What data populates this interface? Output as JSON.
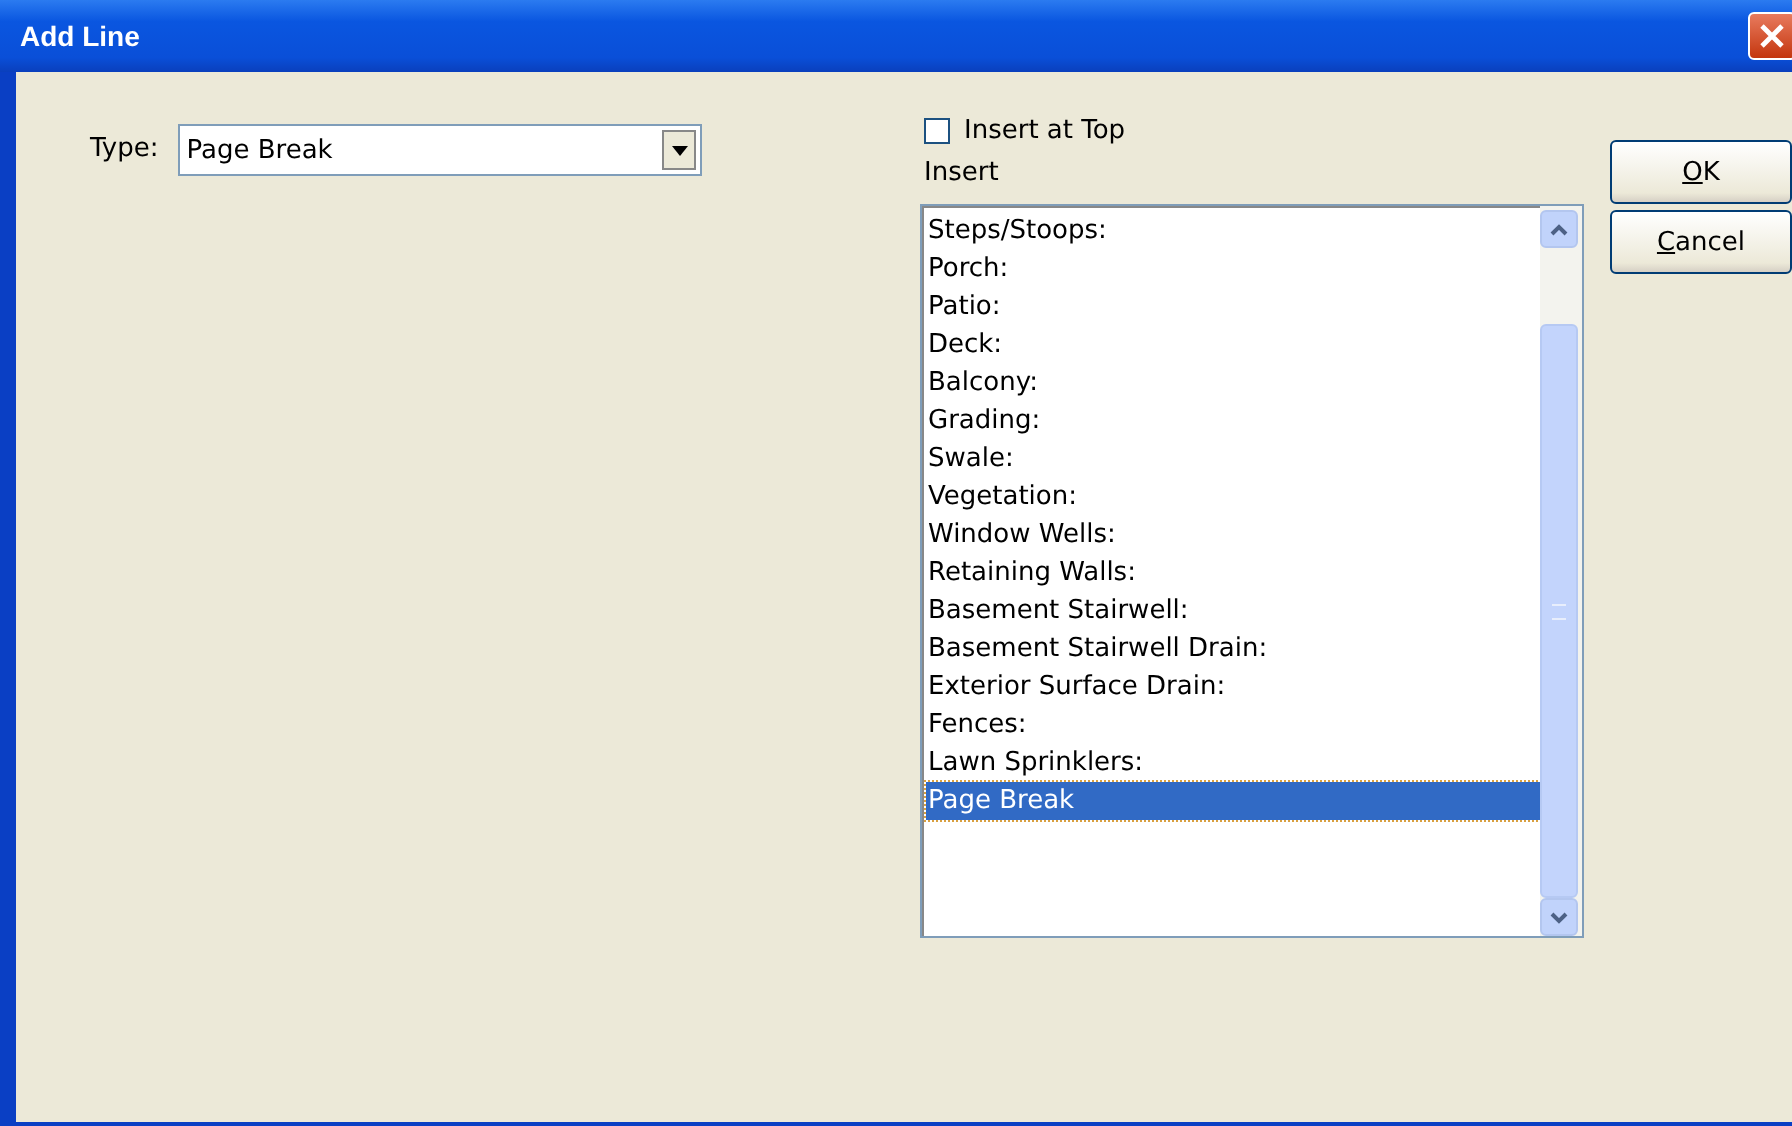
{
  "window": {
    "title": "Add Line"
  },
  "type_field": {
    "label": "Type:",
    "value": "Page Break"
  },
  "insert_at_top": {
    "label": "Insert at Top",
    "checked": false
  },
  "insert_list": {
    "label": "Insert",
    "items": [
      {
        "text": "Steps/Stoops:",
        "selected": false
      },
      {
        "text": "Porch:",
        "selected": false
      },
      {
        "text": "Patio:",
        "selected": false
      },
      {
        "text": "Deck:",
        "selected": false
      },
      {
        "text": "Balcony:",
        "selected": false
      },
      {
        "text": "Grading:",
        "selected": false
      },
      {
        "text": "Swale:",
        "selected": false
      },
      {
        "text": "Vegetation:",
        "selected": false
      },
      {
        "text": "Window Wells:",
        "selected": false
      },
      {
        "text": "Retaining Walls:",
        "selected": false
      },
      {
        "text": "Basement Stairwell:",
        "selected": false
      },
      {
        "text": "Basement Stairwell Drain:",
        "selected": false
      },
      {
        "text": "Exterior Surface Drain:",
        "selected": false
      },
      {
        "text": "Fences:",
        "selected": false
      },
      {
        "text": "Lawn Sprinklers:",
        "selected": false
      },
      {
        "text": "Page Break",
        "selected": true
      }
    ]
  },
  "buttons": [
    "OK",
    "Cancel"
  ]
}
